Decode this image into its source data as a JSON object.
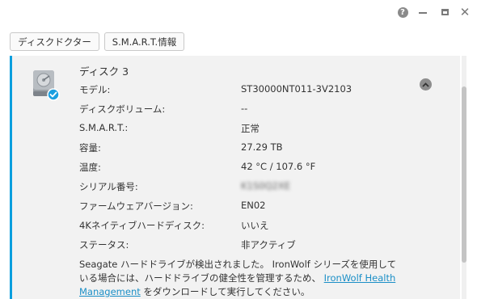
{
  "window": {
    "help_glyph": "?",
    "close_glyph": "✕"
  },
  "toolbar": {
    "disk_doctor_label": "ディスクドクター",
    "smart_info_label": "S.M.A.R.T.情報"
  },
  "disk": {
    "title": "ディスク 3",
    "status_icon": "checkmark-badge-icon",
    "properties": [
      {
        "label": "モデル:",
        "value": "ST30000NT011-3V2103"
      },
      {
        "label": "ディスクボリューム:",
        "value": "--"
      },
      {
        "label": "S.M.A.R.T.:",
        "value": "正常"
      },
      {
        "label": "容量:",
        "value": "27.29 TB"
      },
      {
        "label": "温度:",
        "value": "42 °C / 107.6 °F"
      },
      {
        "label": "シリアル番号:",
        "value": "K1S0Q2XE"
      },
      {
        "label": "ファームウェアバージョン:",
        "value": "EN02"
      },
      {
        "label": "4Kネイティブハードディスク:",
        "value": "いいえ"
      },
      {
        "label": "ステータス:",
        "value": "非アクティブ"
      }
    ],
    "note_text": "Seagate ハードドライブが検出されました。 IronWolf シリーズを使用している場合には、ハードドライブの健全性を管理するため、",
    "note_link": "IronWolf Health Management",
    "note_suffix": "をダウンロードして実行してください。"
  },
  "colors": {
    "accent": "#0a9fde",
    "link": "#1b8fc7",
    "panel_bg": "#f2f2f2"
  }
}
